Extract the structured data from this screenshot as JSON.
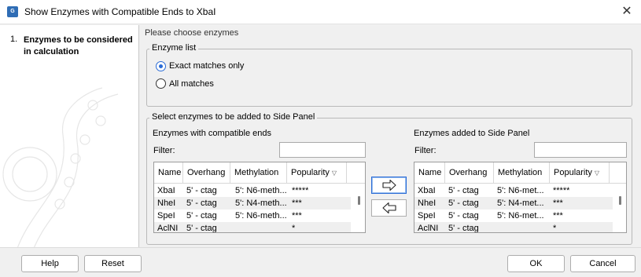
{
  "window": {
    "title": "Show Enzymes with Compatible Ends to XbaI",
    "app_icon_text": "G"
  },
  "wizard": {
    "step_number": "1.",
    "step_label": "Enzymes to be considered in calculation"
  },
  "content": {
    "choose_label": "Please choose enzymes",
    "enzyme_list": {
      "legend": "Enzyme list",
      "options": [
        {
          "label": "Exact matches only",
          "selected": true
        },
        {
          "label": "All matches",
          "selected": false
        }
      ]
    },
    "select_group": {
      "legend": "Select enzymes to be added to Side Panel",
      "left_panel": {
        "title": "Enzymes with compatible ends",
        "filter_label": "Filter:",
        "filter_value": "",
        "columns": [
          "Name",
          "Overhang",
          "Methylation",
          "Popularity"
        ],
        "rows": [
          [
            "XbaI",
            "5' - ctag",
            "5': N6-meth...",
            "*****"
          ],
          [
            "NheI",
            "5' - ctag",
            "5': N4-meth...",
            "***"
          ],
          [
            "SpeI",
            "5' - ctag",
            "5': N6-meth...",
            "***"
          ],
          [
            "AclNI",
            "5' - ctag",
            "",
            "*"
          ]
        ]
      },
      "right_panel": {
        "title": "Enzymes added to Side Panel",
        "filter_label": "Filter:",
        "filter_value": "",
        "columns": [
          "Name",
          "Overhang",
          "Methylation",
          "Popularity"
        ],
        "rows": [
          [
            "XbaI",
            "5' - ctag",
            "5': N6-met...",
            "*****"
          ],
          [
            "NheI",
            "5' - ctag",
            "5': N4-met...",
            "***"
          ],
          [
            "SpeI",
            "5' - ctag",
            "5': N6-met...",
            "***"
          ],
          [
            "AclNI",
            "5' - ctag",
            "",
            "*"
          ]
        ]
      },
      "add_icon": "arrow-right-icon",
      "remove_icon": "arrow-left-icon"
    }
  },
  "footer": {
    "help": "Help",
    "reset": "Reset",
    "ok": "OK",
    "cancel": "Cancel"
  },
  "colors": {
    "accent": "#2a6bd6",
    "window_bg": "#f0f0f0"
  }
}
